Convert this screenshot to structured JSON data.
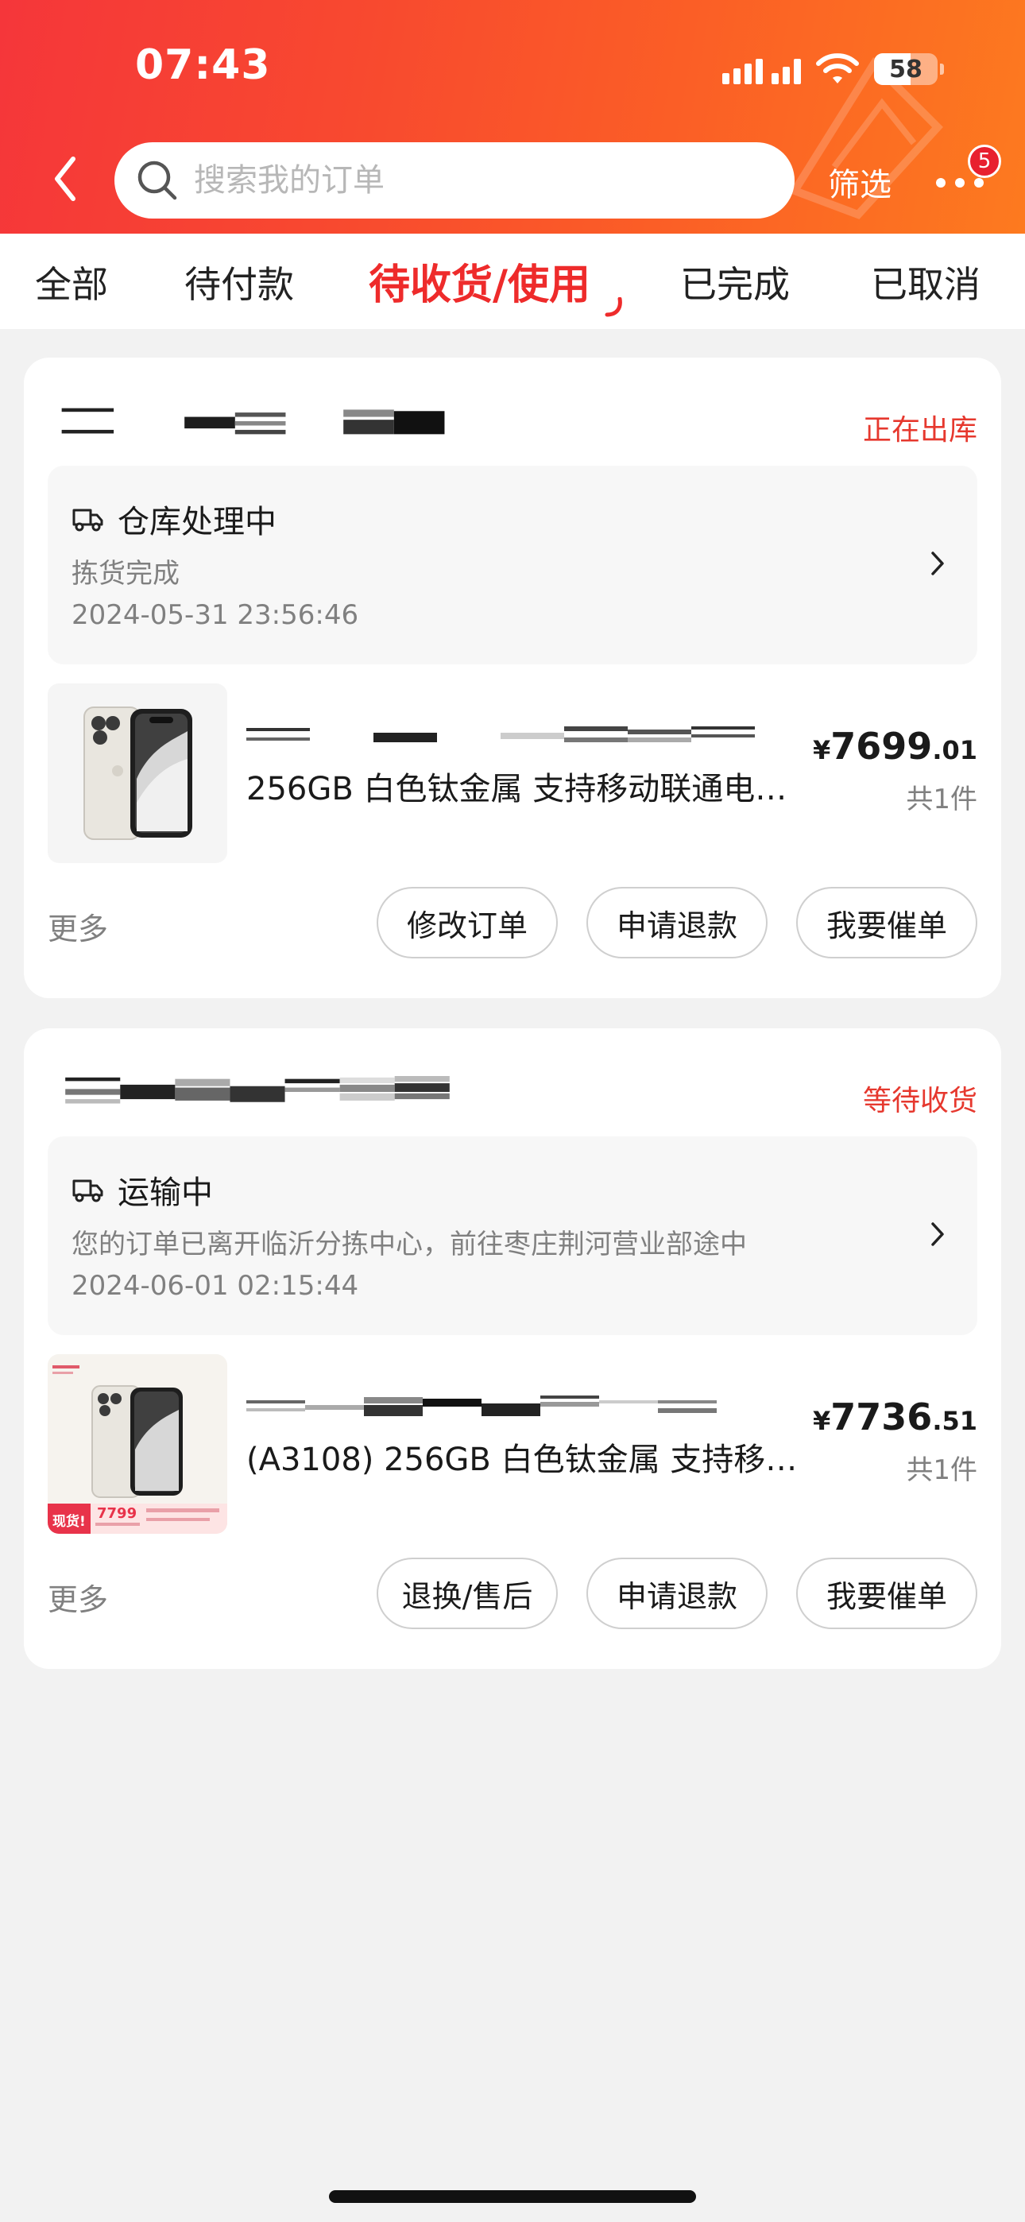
{
  "status_bar": {
    "time": "07:43",
    "battery": "58"
  },
  "header": {
    "search": {
      "placeholder": "搜索我的订单"
    },
    "filter_label": "筛选",
    "more_badge": "5"
  },
  "tabs": [
    {
      "label": "全部"
    },
    {
      "label": "待付款"
    },
    {
      "label": "待收货/使用"
    },
    {
      "label": "已完成"
    },
    {
      "label": "已取消"
    }
  ],
  "active_tab": "待收货/使用",
  "orders": [
    {
      "status": "正在出库",
      "logistics": {
        "title": "仓库处理中",
        "desc": "拣货完成",
        "time": "2024-05-31 23:56:46"
      },
      "product": {
        "name": "256GB 白色钛金属 支持移动联通电…",
        "price": {
          "currency": "¥",
          "integer": "7699",
          "decimal": ".01"
        },
        "quantity": "共1件"
      },
      "more_label": "更多",
      "buttons": [
        "修改订单",
        "申请退款",
        "我要催单"
      ]
    },
    {
      "status": "等待收货",
      "logistics": {
        "title": "运输中",
        "desc": "您的订单已离开临沂分拣中心，前往枣庄荆河营业部途中",
        "time": "2024-06-01 02:15:44"
      },
      "product": {
        "name": "(A3108) 256GB 白色钛金属 支持移…",
        "price": {
          "currency": "¥",
          "integer": "7736",
          "decimal": ".51"
        },
        "quantity": "共1件",
        "thumb_tag": "现货!",
        "thumb_price": "7799"
      },
      "more_label": "更多",
      "buttons": [
        "退换/售后",
        "申请退款",
        "我要催单"
      ]
    }
  ],
  "colors": {
    "accent_red": "#ee2b2b",
    "status_red": "#e6382e",
    "header_gradient_start": "#f5363a",
    "header_gradient_end": "#fd7a1f"
  }
}
